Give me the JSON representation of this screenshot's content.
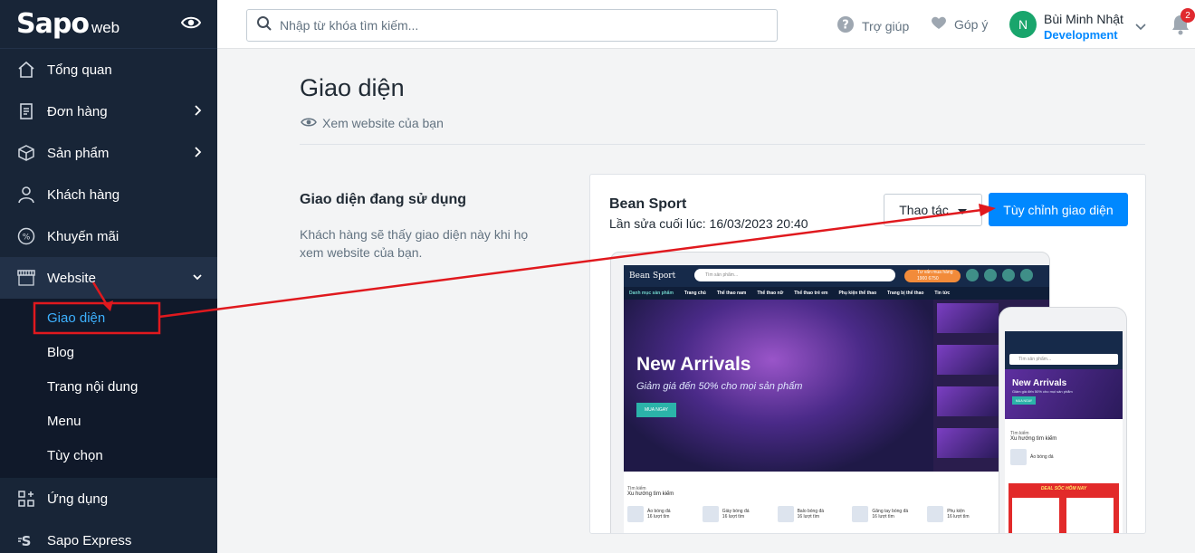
{
  "sidebar": {
    "logo": "Sapo",
    "logo_suffix": "web",
    "items": [
      {
        "label": "Tổng quan",
        "icon": "home-icon"
      },
      {
        "label": "Đơn hàng",
        "icon": "order-icon"
      },
      {
        "label": "Sản phẩm",
        "icon": "box-icon"
      },
      {
        "label": "Khách hàng",
        "icon": "user-icon"
      },
      {
        "label": "Khuyến mãi",
        "icon": "discount-icon"
      },
      {
        "label": "Website",
        "icon": "store-icon"
      },
      {
        "label": "Ứng dụng",
        "icon": "apps-icon"
      },
      {
        "label": "Sapo Express",
        "icon": "express-icon"
      }
    ],
    "website_submenu": [
      "Giao diện",
      "Blog",
      "Trang nội dung",
      "Menu",
      "Tùy chọn"
    ]
  },
  "header": {
    "search_placeholder": "Nhập từ khóa tìm kiếm...",
    "help": "Trợ giúp",
    "feedback": "Góp ý",
    "user": {
      "initial": "N",
      "name": "Bùi Minh Nhật",
      "role": "Development"
    },
    "notifications": "2"
  },
  "page": {
    "title": "Giao diện",
    "view_site": "Xem website của bạn",
    "section_title": "Giao diện đang sử dụng",
    "section_desc": "Khách hàng sẽ thấy giao diện này khi họ xem website của bạn.",
    "theme": {
      "name": "Bean Sport",
      "last_edited": "Lần sửa cuối lúc: 16/03/2023 20:40",
      "action_button": "Thao tác",
      "customize_button": "Tùy chỉnh giao diện"
    }
  },
  "preview": {
    "brand": "Bean Sport",
    "search": "Tìm sản phẩm...",
    "hotline_label": "Tư vấn mua hàng",
    "hotline": "1900 6750",
    "nav": [
      "Danh mục sản phẩm",
      "Trang chủ",
      "Thể thao nam",
      "Thể thao nữ",
      "Thể thao trẻ em",
      "Phụ kiện thể thao",
      "Trang bị thể thao",
      "Tin tức"
    ],
    "banner_title": "New Arrivals",
    "banner_sub": "Giảm giá đến 50% cho mọi sản phẩm",
    "banner_button": "MUA NGAY",
    "search_label": "Tìm kiếm",
    "trend_label": "Xu hướng tìm kiếm",
    "products": [
      "Áo bóng đá",
      "Giày bóng đá",
      "Balo bóng đá",
      "Găng tay bóng đá",
      "Phụ kiện"
    ],
    "products_sub": "16 lượt tìm",
    "phone_deal": "DEAL SỐC HÔM NAY"
  },
  "colors": {
    "accent": "#0088ff",
    "sidebar": "#182537",
    "annotation": "#e0191e"
  }
}
